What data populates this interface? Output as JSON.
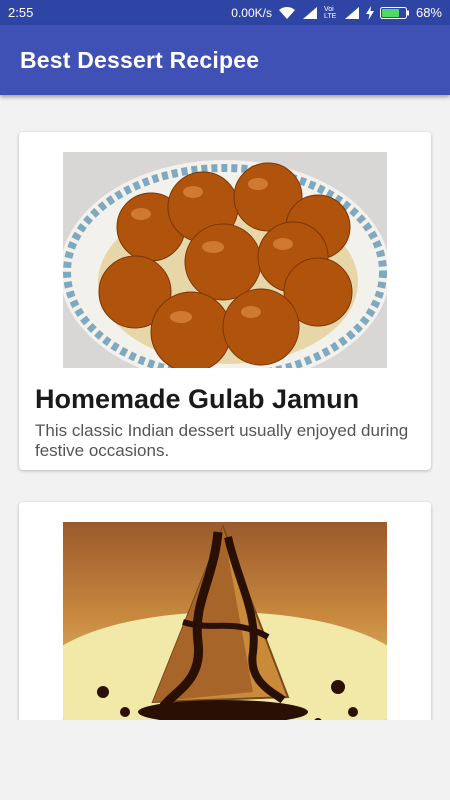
{
  "status_bar": {
    "time": "2:55",
    "network_speed": "0.00K/s",
    "network_label": "Voi LTE",
    "battery_percent": "68%"
  },
  "toolbar": {
    "title": "Best Dessert Recipee"
  },
  "recipes": [
    {
      "title": "Homemade Gulab Jamun",
      "description": "This classic Indian dessert usually enjoyed during festive occasions."
    },
    {}
  ]
}
